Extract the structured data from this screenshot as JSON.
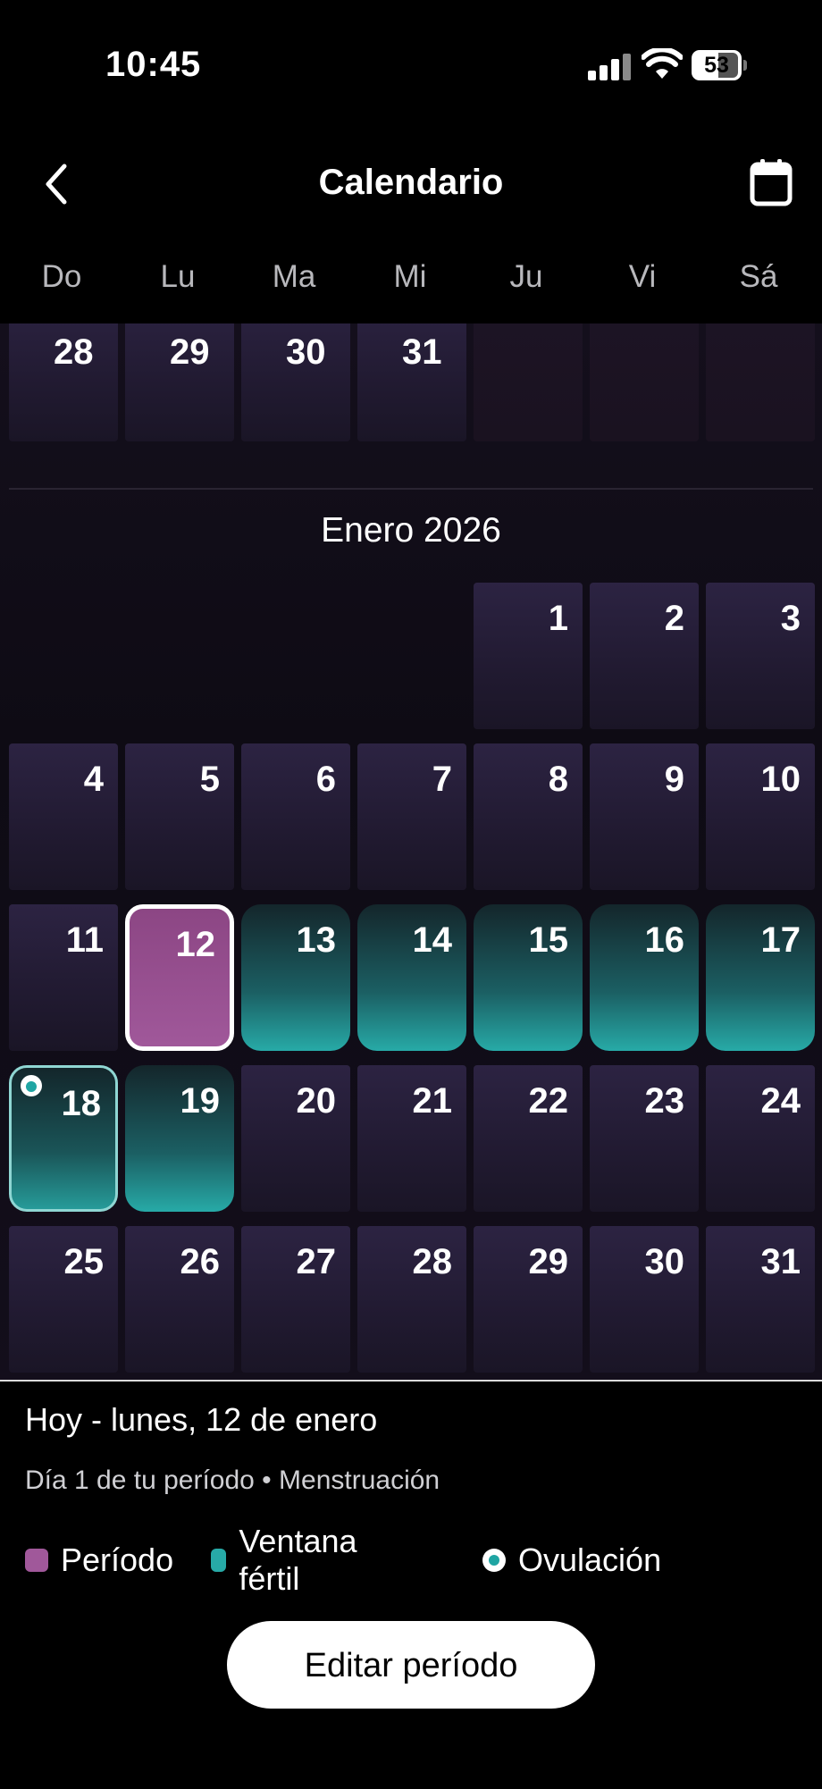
{
  "status_bar": {
    "time": "10:45",
    "battery": "53"
  },
  "header": {
    "title": "Calendario",
    "back_icon": "chevron-left-icon",
    "calendar_icon": "calendar-icon"
  },
  "weekdays": [
    "Do",
    "Lu",
    "Ma",
    "Mi",
    "Ju",
    "Vi",
    "Sá"
  ],
  "previous_month": {
    "days": [
      28,
      29,
      30,
      31
    ]
  },
  "month": {
    "title": "Enero 2026",
    "weeks": [
      [
        null,
        null,
        null,
        null,
        1,
        2,
        3
      ],
      [
        4,
        5,
        6,
        7,
        8,
        9,
        10
      ],
      [
        11,
        12,
        13,
        14,
        15,
        16,
        17
      ],
      [
        18,
        19,
        20,
        21,
        22,
        23,
        24
      ],
      [
        25,
        26,
        27,
        28,
        29,
        30,
        31
      ]
    ],
    "period_days": [
      12
    ],
    "fertile_days": [
      13,
      14,
      15,
      16,
      17,
      18,
      19
    ],
    "ovulation_days": [
      18
    ],
    "today": 12
  },
  "info": {
    "today_label": "Hoy - lunes, 12 de enero",
    "cycle_label": "Día 1 de tu período • Menstruación"
  },
  "legend": {
    "period": "Período",
    "fertile": "Ventana fértil",
    "ovulation": "Ovulación"
  },
  "colors": {
    "period": "#a0589a",
    "fertile": "#27aaa7",
    "ovulation_dot": "#1fa5a3"
  },
  "edit_button": {
    "label": "Editar período"
  }
}
